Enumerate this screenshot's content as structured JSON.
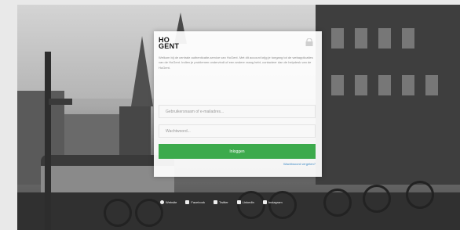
{
  "brand": {
    "logo_line1": "HO",
    "logo_line2": "GENT"
  },
  "intro_text": "Welkom bij de centrale authenticatie-service van HoGent. Met dit account krijg je toegang tot de webapplicaties van de HoGent. Indien je problemen ondervindt of een andere vraag hebt, contacteer dan de helpdesk van de HoGent.",
  "form": {
    "username_placeholder": "Gebruikersnaam of e-mailadres...",
    "password_placeholder": "Wachtwoord...",
    "login_label": "Inloggen",
    "forgot_label": "Wachtwoord vergeten?"
  },
  "footer": {
    "links": [
      {
        "label": "Website",
        "icon": "globe-icon"
      },
      {
        "label": "Facebook",
        "icon": "facebook-icon"
      },
      {
        "label": "Twitter",
        "icon": "twitter-icon"
      },
      {
        "label": "LinkedIn",
        "icon": "linkedin-icon"
      },
      {
        "label": "Instagram",
        "icon": "instagram-icon"
      }
    ]
  },
  "colors": {
    "accent_green": "#3caa4c",
    "link_blue": "#3b88c4"
  }
}
